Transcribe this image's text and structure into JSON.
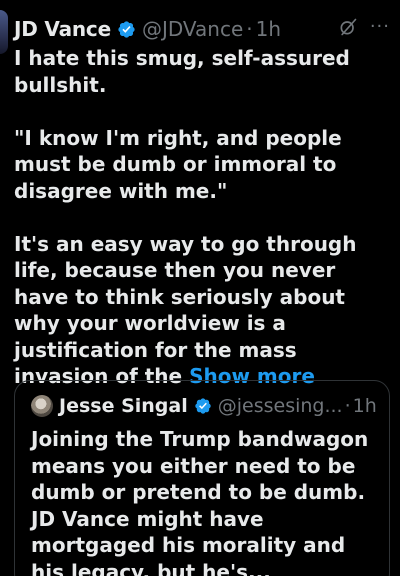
{
  "tweet": {
    "author_name": "JD Vance",
    "handle": "@JDVance",
    "separator": "·",
    "time": "1h",
    "more_label": "···",
    "paragraph_1": "I hate this smug, self-assured bullshit.",
    "paragraph_2": "\"I know I'm right, and people must be dumb or immoral to disagree with me.\"",
    "paragraph_3": "It's an easy way to go through life, because then you never have to think seriously about why your worldview is a justification for the mass invasion of the",
    "show_more_label": "Show more",
    "icons": [
      "verified-badge-icon",
      "grok-icon",
      "more-icon"
    ]
  },
  "quote": {
    "author_name": "Jesse Singal",
    "handle": "@jessesing...",
    "separator": "·",
    "time": "1h",
    "text": "Joining the Trump bandwagon means you either need to be dumb or pretend to be dumb. JD Vance might have mortgaged his morality and his legacy, but he's...",
    "icons": [
      "avatar",
      "verified-badge-icon"
    ]
  },
  "colors": {
    "background": "#000000",
    "text_primary": "#e7e9ea",
    "text_secondary": "#71767b",
    "link": "#1d9bf0",
    "verified": "#1d9bf0",
    "border": "#2f3336"
  }
}
